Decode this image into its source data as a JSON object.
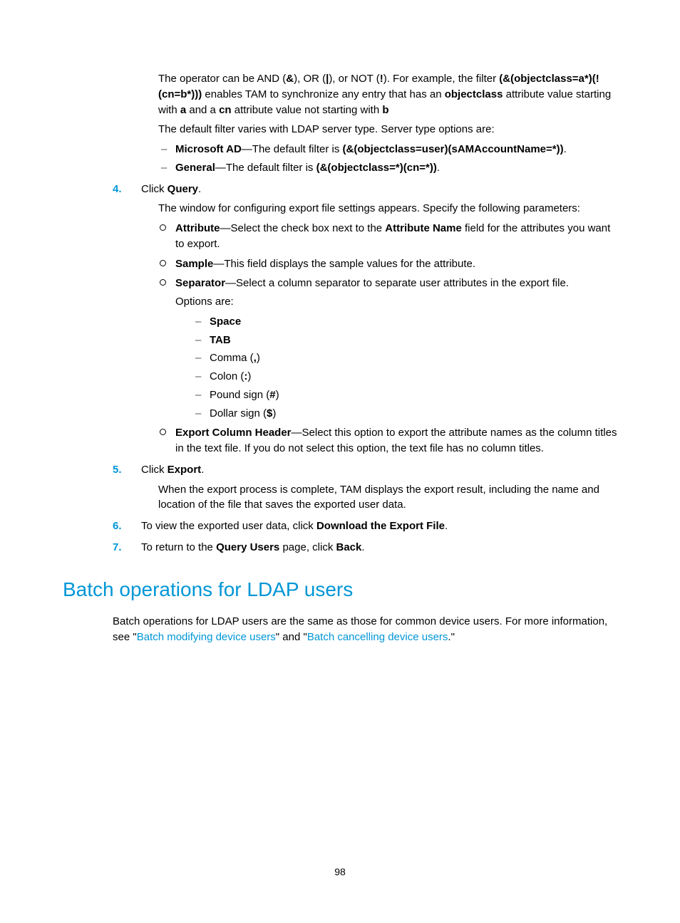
{
  "intro": {
    "p1_pre": "The operator can be AND (",
    "p1_b1": "&",
    "p1_mid1": "), OR (",
    "p1_b2": "|",
    "p1_mid2": "), or NOT (",
    "p1_b3": "!",
    "p1_mid3": "). For example, the filter ",
    "p1_b4": "(&(objectclass=a*)(!(cn=b*)))",
    "p1_mid4": " enables TAM to synchronize any entry that has an ",
    "p1_b5": "objectclass",
    "p1_mid5": " attribute value starting with ",
    "p1_b6": "a",
    "p1_mid6": " and a ",
    "p1_b7": "cn",
    "p1_mid7": " attribute value not starting with ",
    "p1_b8": "b",
    "p2": "The default filter varies with LDAP server type. Server type options are:",
    "li1_b1": "Microsoft AD",
    "li1_txt": "—The default filter is ",
    "li1_b2": "(&(objectclass=user)(sAMAccountName=*))",
    "li1_dot": ".",
    "li2_b1": "General",
    "li2_txt": "—The default filter is ",
    "li2_b2": "(&(objectclass=*)(cn=*))",
    "li2_dot": "."
  },
  "steps": {
    "s4": {
      "num": "4.",
      "txt_pre": "Click ",
      "txt_b": "Query",
      "txt_post": ".",
      "para": "The window for configuring export file settings appears. Specify the following parameters:",
      "attr_b": "Attribute",
      "attr_txt1": "—Select the check box next to the ",
      "attr_b2": "Attribute Name",
      "attr_txt2": " field for the attributes you want to export.",
      "samp_b": "Sample",
      "samp_txt": "—This field displays the sample values for the attribute.",
      "sep_b": "Separator",
      "sep_txt": "—Select a column separator to separate user attributes in the export file.",
      "sep_opts": "Options are:",
      "opt_space": "Space",
      "opt_tab": "TAB",
      "opt_comma_pre": "Comma (",
      "opt_comma_b": ",",
      "opt_comma_post": ")",
      "opt_colon_pre": "Colon (",
      "opt_colon_b": ":",
      "opt_colon_post": ")",
      "opt_pound_pre": "Pound sign (",
      "opt_pound_b": "#",
      "opt_pound_post": ")",
      "opt_dollar_pre": "Dollar sign (",
      "opt_dollar_b": "$",
      "opt_dollar_post": ")",
      "ech_b": "Export Column Header",
      "ech_txt": "—Select this option to export the attribute names as the column titles in the text file. If you do not select this option, the text file has no column titles."
    },
    "s5": {
      "num": "5.",
      "txt_pre": "Click ",
      "txt_b": "Export",
      "txt_post": ".",
      "para": "When the export process is complete, TAM displays the export result, including the name and location of the file that saves the exported user data."
    },
    "s6": {
      "num": "6.",
      "txt_pre": "To view the exported user data, click ",
      "txt_b": "Download the Export File",
      "txt_post": "."
    },
    "s7": {
      "num": "7.",
      "txt_pre": "To return to the ",
      "txt_b1": "Query Users",
      "txt_mid": " page, click ",
      "txt_b2": "Back",
      "txt_post": "."
    }
  },
  "section": {
    "heading": "Batch operations for LDAP users",
    "body_pre": "Batch operations for LDAP users are the same as those for common device users. For more information, see \"",
    "link1": "Batch modifying device users",
    "body_mid": "\" and \"",
    "link2": "Batch cancelling device users",
    "body_post": ".\""
  },
  "pagenum": "98"
}
